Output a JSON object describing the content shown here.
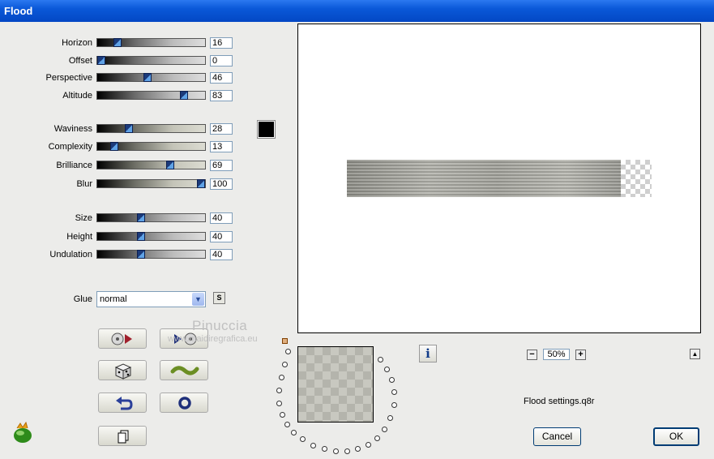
{
  "window": {
    "title": "Flood"
  },
  "sliders": [
    {
      "id": "horizon",
      "label": "Horizon",
      "value": "16",
      "pos": 16
    },
    {
      "id": "offset",
      "label": "Offset",
      "value": "0",
      "pos": 0
    },
    {
      "id": "perspective",
      "label": "Perspective",
      "value": "46",
      "pos": 46
    },
    {
      "id": "altitude",
      "label": "Altitude",
      "value": "83",
      "pos": 83
    },
    {
      "id": "waviness",
      "label": "Waviness",
      "value": "28",
      "pos": 28
    },
    {
      "id": "complexity",
      "label": "Complexity",
      "value": "13",
      "pos": 13
    },
    {
      "id": "brilliance",
      "label": "Brilliance",
      "value": "69",
      "pos": 69
    },
    {
      "id": "blur",
      "label": "Blur",
      "value": "100",
      "pos": 100
    },
    {
      "id": "size",
      "label": "Size",
      "value": "40",
      "pos": 40
    },
    {
      "id": "height",
      "label": "Height",
      "value": "40",
      "pos": 40
    },
    {
      "id": "undulation",
      "label": "Undulation",
      "value": "40",
      "pos": 40
    }
  ],
  "color_swatch": "#000000",
  "glue": {
    "label": "Glue",
    "value": "normal",
    "s_button": "S"
  },
  "watermark": {
    "line1": "Pinuccia",
    "line2": "www.maidiregrafica.eu"
  },
  "preview": {
    "zoom": "50%",
    "settings_file": "Flood settings.q8r"
  },
  "buttons": {
    "cancel": "Cancel",
    "ok": "OK"
  }
}
